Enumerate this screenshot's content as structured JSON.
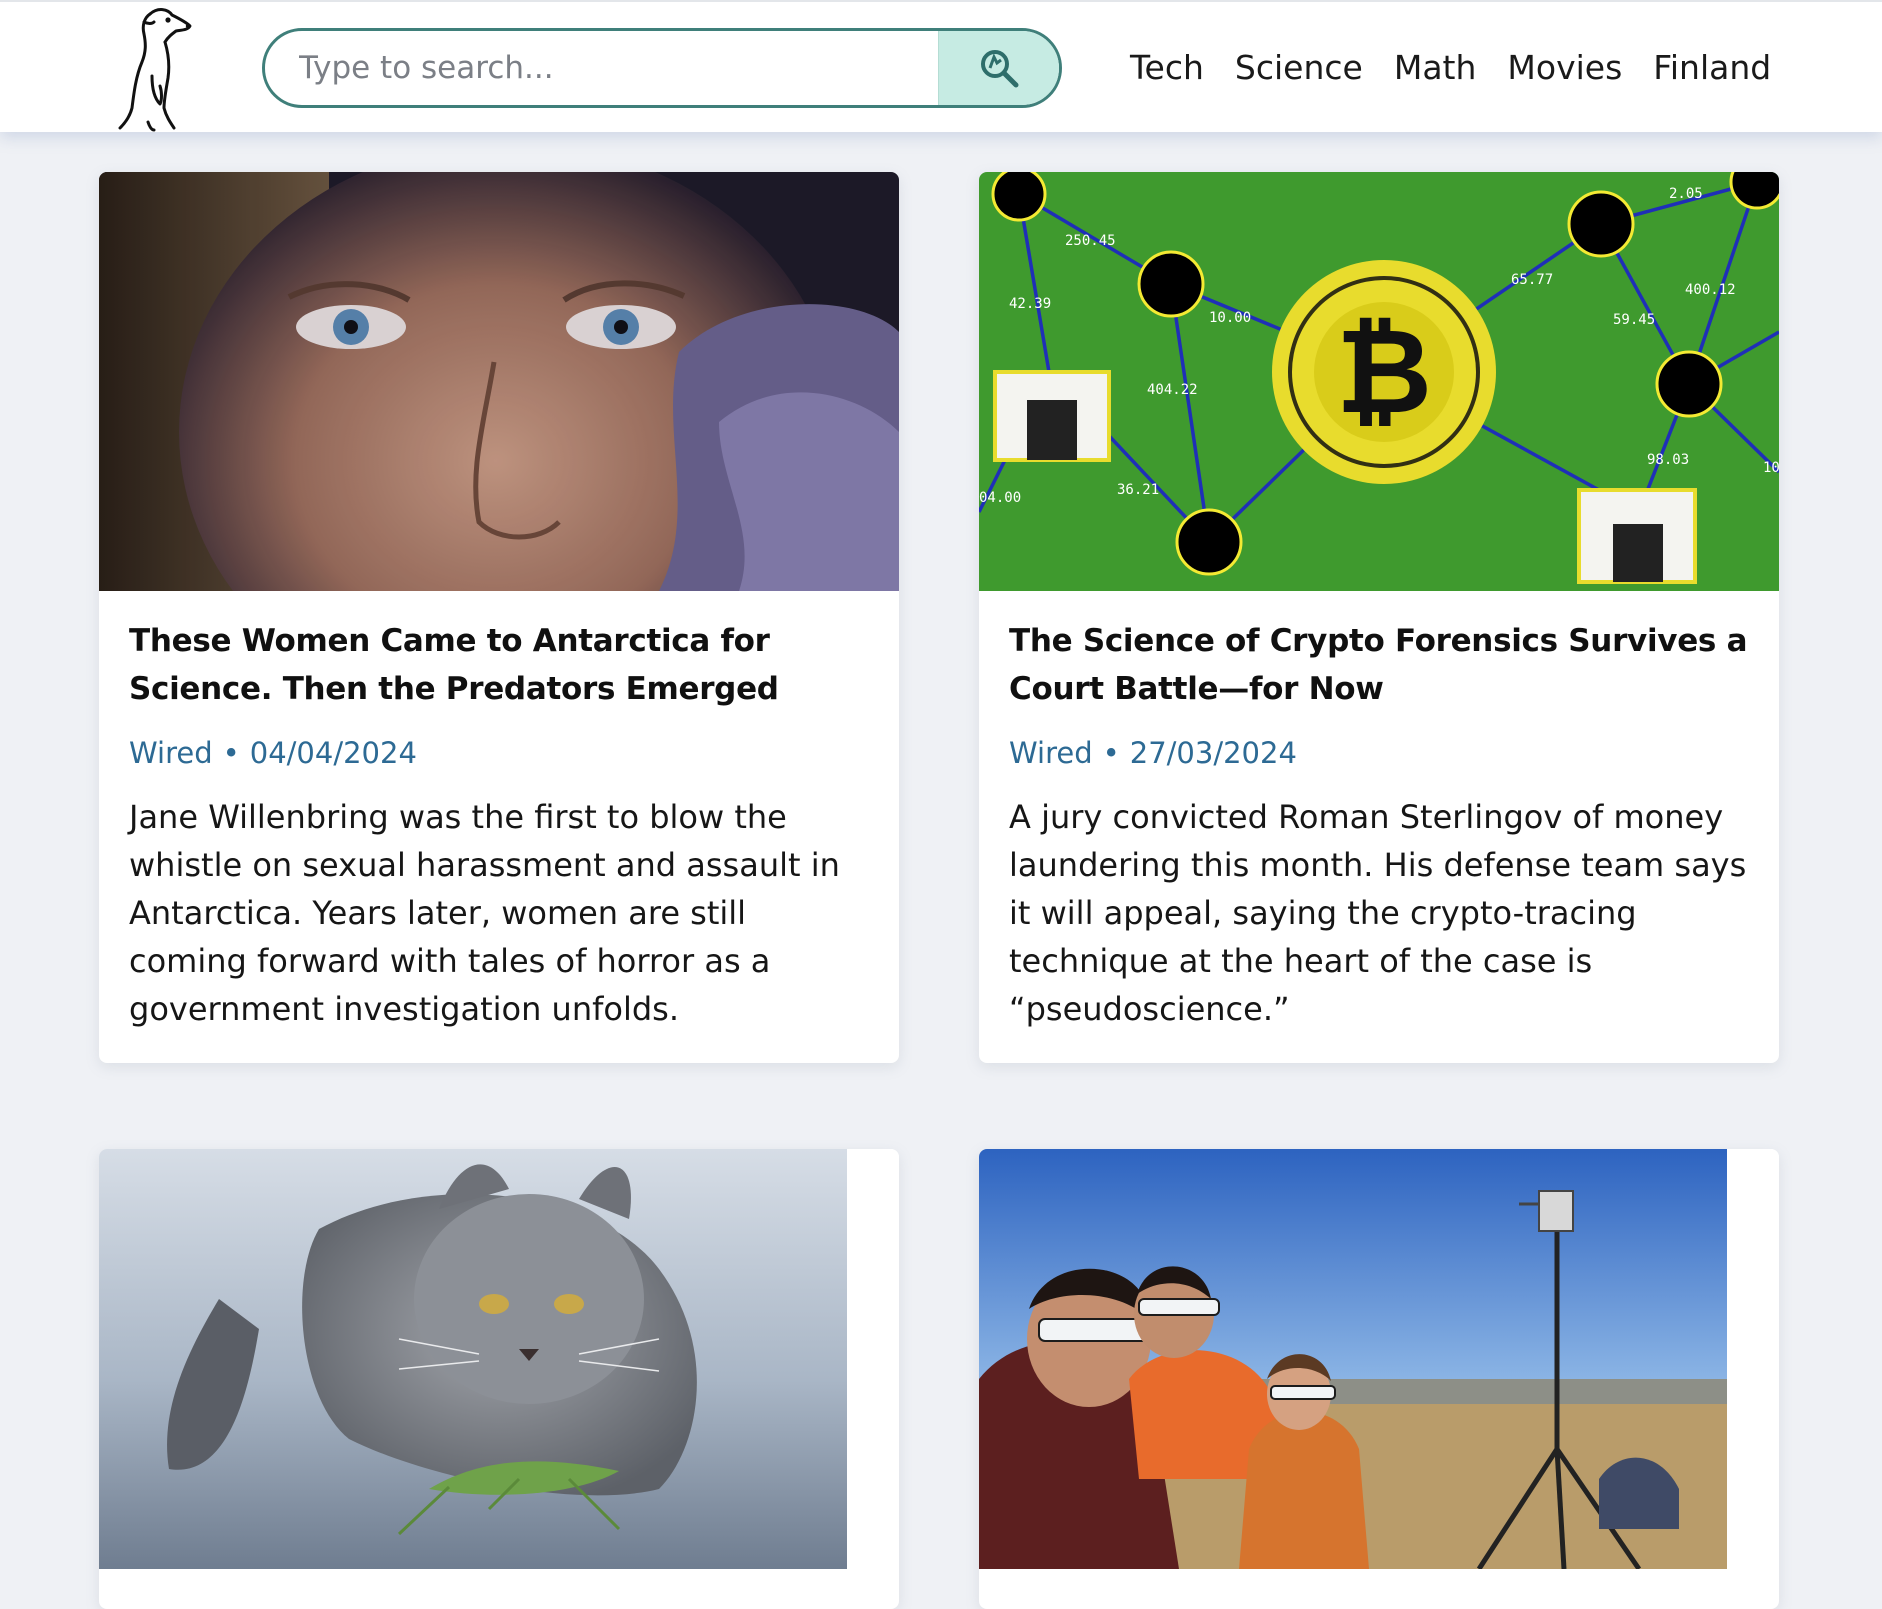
{
  "header": {
    "search_placeholder": "Type to search...",
    "nav": [
      "Tech",
      "Science",
      "Math",
      "Movies",
      "Finland"
    ]
  },
  "articles": [
    {
      "title": "These Women Came to Antarctica for Science. Then the Predators Emerged",
      "source": "Wired",
      "separator": "•",
      "date": "04/04/2024",
      "description": "Jane Willenbring was the first to blow the whistle on sexual harassment and assault in Antarctica. Years later, women are still coming forward with tales of horror as a government investigation unfolds."
    },
    {
      "title": "The Science of Crypto Forensics Survives a Court Battle—for Now",
      "source": "Wired",
      "separator": "•",
      "date": "27/03/2024",
      "description": "A jury convicted Roman Sterlingov of money laundering this month. His defense team says it will appeal, saying the crypto-tracing technique at the heart of the case is “pseudoscience.”",
      "image_labels": [
        "250.45",
        "42.39",
        "10.00",
        "404.22",
        "36.21",
        "04.00",
        "65.77",
        "2.05",
        "400.12",
        "59.45",
        "98.03",
        "10"
      ]
    },
    {
      "image": "gray cat looking at grasshopper"
    },
    {
      "image": "students wearing eclipse glasses next to weather station"
    }
  ]
}
